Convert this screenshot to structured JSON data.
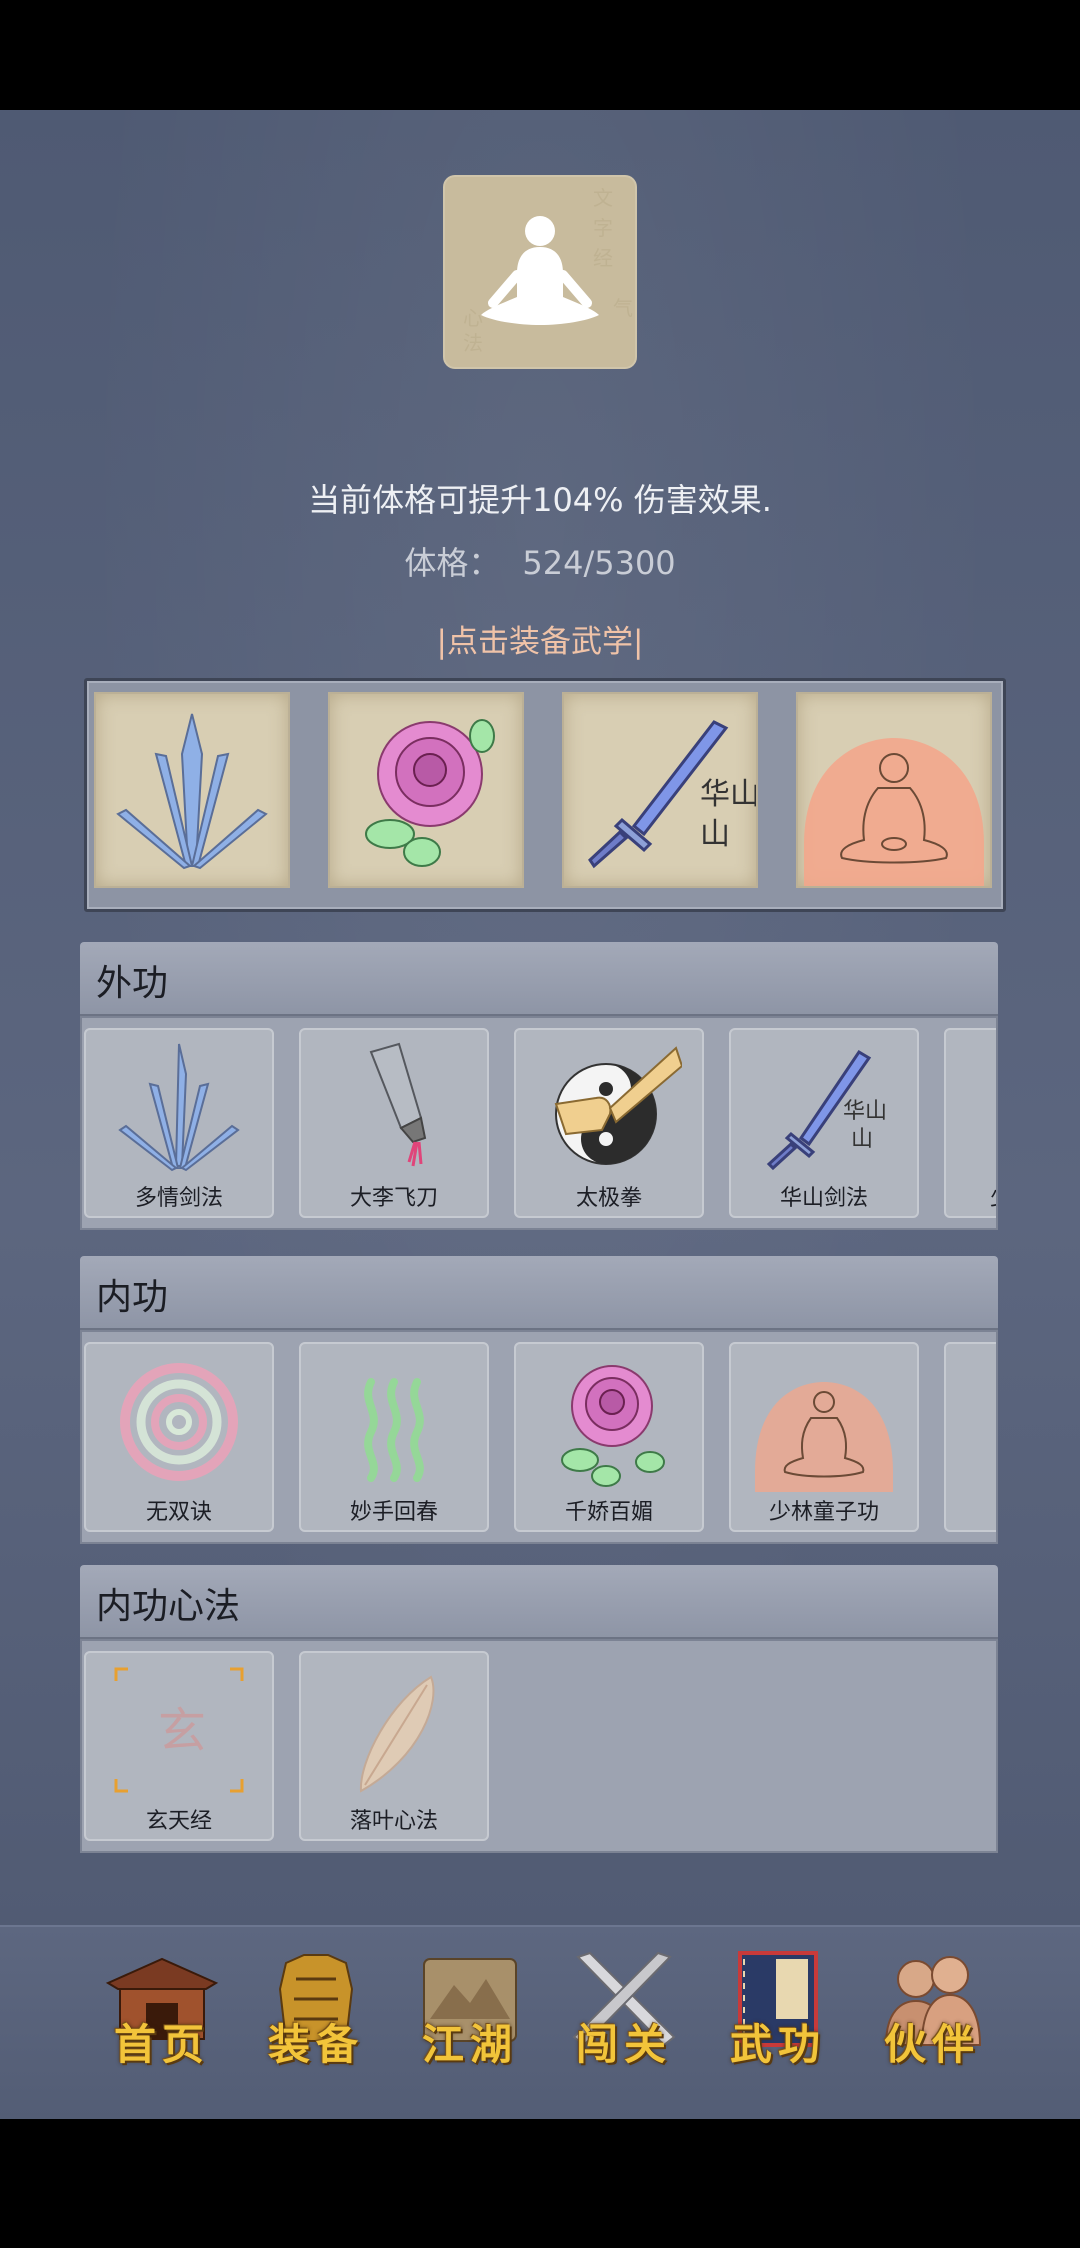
{
  "header": {
    "bonus_text": "当前体格可提升104% 伤害效果.",
    "stat_label": "体格：",
    "stat_value": "524/5300",
    "equip_link": "|点击装备武学|"
  },
  "equipped": [
    {
      "icon": "blue-crystal-sword-icon"
    },
    {
      "icon": "pink-rose-icon"
    },
    {
      "icon": "huashan-sword-icon",
      "text": "华山"
    },
    {
      "icon": "meditating-monk-icon"
    }
  ],
  "sections": {
    "waigong": {
      "title": "外功",
      "items": [
        {
          "label": "多情剑法",
          "icon": "blue-crystal-sword-icon"
        },
        {
          "label": "大李飞刀",
          "icon": "cleaver-knife-icon"
        },
        {
          "label": "太极拳",
          "icon": "taiji-fist-icon"
        },
        {
          "label": "华山剑法",
          "icon": "huashan-sword-icon",
          "text": "华山"
        },
        {
          "label": "少",
          "icon": "partial-card-icon"
        }
      ]
    },
    "neigong": {
      "title": "内功",
      "items": [
        {
          "label": "无双诀",
          "icon": "spiral-icon"
        },
        {
          "label": "妙手回春",
          "icon": "green-waves-icon"
        },
        {
          "label": "千娇百媚",
          "icon": "pink-rose-icon"
        },
        {
          "label": "少林童子功",
          "icon": "meditating-monk-icon"
        },
        {
          "label": "",
          "icon": "partial-card-icon"
        }
      ]
    },
    "xinfa": {
      "title": "内功心法",
      "items": [
        {
          "label": "玄天经",
          "icon": "xuan-scroll-icon",
          "text": "玄"
        },
        {
          "label": "落叶心法",
          "icon": "leaf-icon"
        }
      ]
    }
  },
  "nav": [
    {
      "label": "首页",
      "icon": "temple-icon"
    },
    {
      "label": "装备",
      "icon": "armor-icon"
    },
    {
      "label": "江湖",
      "icon": "scroll-map-icon"
    },
    {
      "label": "闯关",
      "icon": "crossed-swords-icon"
    },
    {
      "label": "武功",
      "icon": "martial-book-icon"
    },
    {
      "label": "伙伴",
      "icon": "companions-icon"
    }
  ],
  "colors": {
    "background": "#56607a",
    "link": "#f0c3a8",
    "nav_label": "#f2c43a"
  }
}
